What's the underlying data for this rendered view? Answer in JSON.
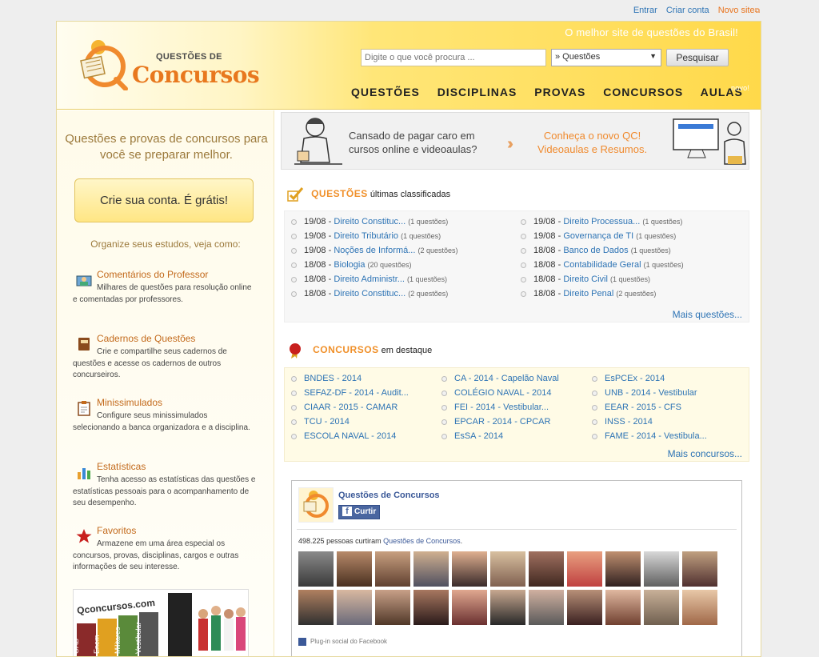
{
  "top_links": {
    "login": "Entrar",
    "signup": "Criar conta",
    "new_site": "Novo site"
  },
  "header": {
    "logo_pre": "QUESTÕES DE",
    "logo_main": "Concursos",
    "tagline": "O melhor site de questões do Brasil!",
    "search_placeholder": "Digite o que você procura ...",
    "search_scope": "» Questões",
    "search_button": "Pesquisar",
    "nav": [
      "QUESTÕES",
      "DISCIPLINAS",
      "PROVAS",
      "CONCURSOS",
      "AULAS"
    ],
    "nav_badge": "novo!"
  },
  "left": {
    "headline": "Questões e provas de concursos para você se preparar melhor.",
    "cta": "Crie sua conta. É grátis!",
    "organize": "Organize seus estudos, veja como:",
    "features": [
      {
        "title": "Comentários do Professor",
        "desc": "Milhares de questões para resolução online e comentadas por professores.",
        "icon": "teacher-icon"
      },
      {
        "title": "Cadernos de Questões",
        "desc": "Crie e compartilhe seus cadernos de questões e acesse os cadernos de outros concurseiros.",
        "icon": "notebook-icon"
      },
      {
        "title": "Minissimulados",
        "desc": "Configure seus minissimulados selecionando a banca organizadora e a disciplina.",
        "icon": "clipboard-icon"
      },
      {
        "title": "Estatísticas",
        "desc": "Tenha acesso as estatísticas das questões e estatísticas pessoais para o acompanhamento de seu desempenho.",
        "icon": "bar-chart-icon"
      },
      {
        "title": "Favoritos",
        "desc": "Armazene em uma área especial os concursos, provas, disciplinas, cargos e outras informações de seu interesse.",
        "icon": "star-icon"
      }
    ],
    "promo_brand": "Qconcursos.com",
    "promo_books": [
      "OAB",
      "Enem",
      "Militares",
      "Vestibular"
    ]
  },
  "banner": {
    "left_line1": "Cansado de pagar caro em",
    "left_line2": "cursos online e videoaulas?",
    "right_line1": "Conheça o novo QC!",
    "right_line2": "Videoaulas e Resumos."
  },
  "questoes": {
    "title": "QUESTÕES",
    "subtitle": "últimas classificadas",
    "left": [
      {
        "date": "19/08",
        "name": "Direito Constituc...",
        "count": "(1 questões)"
      },
      {
        "date": "19/08",
        "name": "Direito Tributário",
        "count": "(1 questões)"
      },
      {
        "date": "19/08",
        "name": "Noções de Informá...",
        "count": "(2 questões)"
      },
      {
        "date": "18/08",
        "name": "Biologia",
        "count": "(20 questões)"
      },
      {
        "date": "18/08",
        "name": "Direito Administr...",
        "count": "(1 questões)"
      },
      {
        "date": "18/08",
        "name": "Direito Constituc...",
        "count": "(2 questões)"
      }
    ],
    "right": [
      {
        "date": "19/08",
        "name": "Direito Processua...",
        "count": "(1 questões)"
      },
      {
        "date": "19/08",
        "name": "Governança de TI",
        "count": "(1 questões)"
      },
      {
        "date": "18/08",
        "name": "Banco de Dados",
        "count": "(1 questões)"
      },
      {
        "date": "18/08",
        "name": "Contabilidade Geral",
        "count": "(1 questões)"
      },
      {
        "date": "18/08",
        "name": "Direito Civil",
        "count": "(1 questões)"
      },
      {
        "date": "18/08",
        "name": "Direito Penal",
        "count": "(2 questões)"
      }
    ],
    "more": "Mais questões..."
  },
  "concursos": {
    "title": "CONCURSOS",
    "subtitle": "em destaque",
    "columns": [
      [
        "BNDES - 2014",
        "SEFAZ-DF - 2014 - Audit...",
        "CIAAR - 2015 - CAMAR",
        "TCU - 2014",
        "ESCOLA NAVAL - 2014"
      ],
      [
        "CA - 2014 - Capelão Naval",
        "COLÉGIO NAVAL - 2014",
        "FEI - 2014 - Vestibular...",
        "EPCAR - 2014 - CPCAR",
        "EsSA - 2014"
      ],
      [
        "EsPCEx - 2014",
        "UNB - 2014 - Vestibular",
        "EEAR - 2015 - CFS",
        "INSS - 2014",
        "FAME - 2014 - Vestibula..."
      ]
    ],
    "more": "Mais concursos..."
  },
  "facebook": {
    "page_name": "Questões de Concursos",
    "like_button": "Curtir",
    "count_number": "498.225",
    "count_text": "pessoas curtiram",
    "count_link": "Questões de Concursos",
    "plugin_text": "Plug-in social do Facebook"
  },
  "colors": {
    "accent": "#f0902a",
    "link": "#2e74b5",
    "header_yellow": "#ffd94a"
  }
}
